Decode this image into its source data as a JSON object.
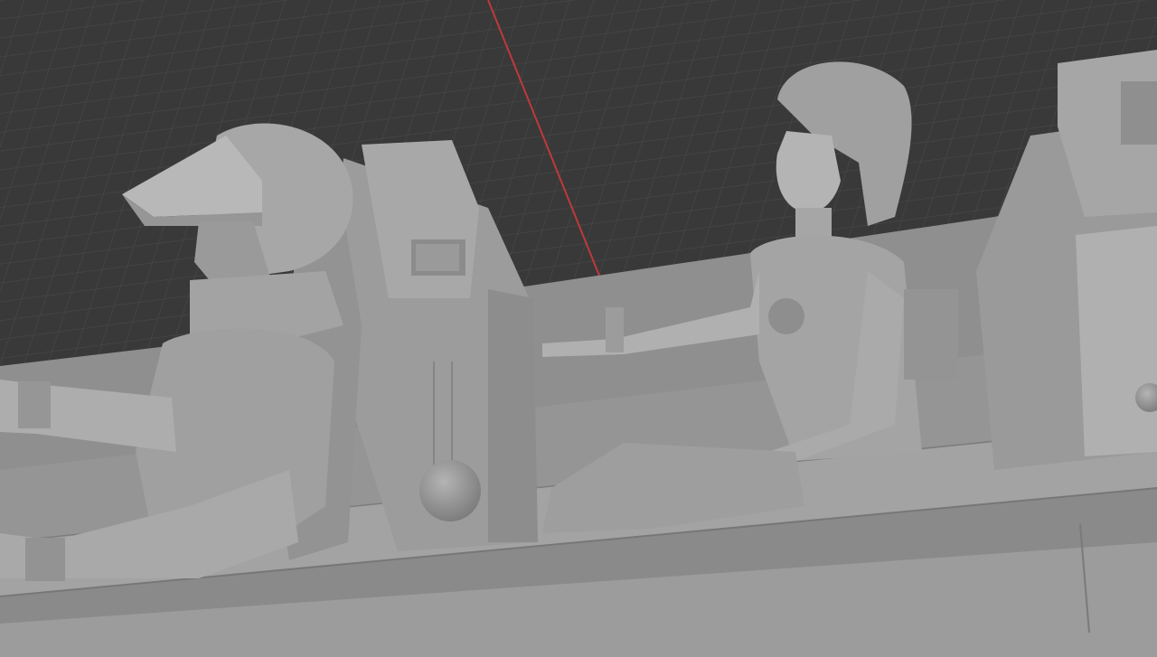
{
  "viewport": {
    "mode": "3d-viewport",
    "shading": "solid",
    "background_color": "#393939",
    "grid_line_color": "#474747",
    "x_axis_color": "#c0393b",
    "model_color": "#9a9a9a",
    "objects": [
      "vehicle-body",
      "pilot-figure-helmet",
      "passenger-figure-girl",
      "pilot-seat",
      "passenger-seat",
      "rear-seat"
    ]
  }
}
